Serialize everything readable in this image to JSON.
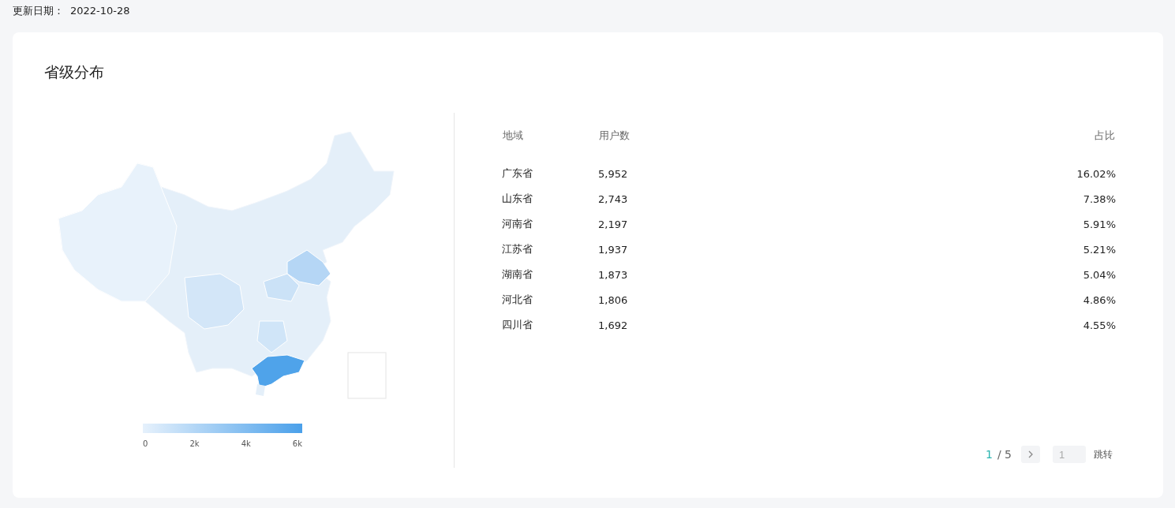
{
  "update": {
    "label": "更新日期：",
    "date": "2022-10-28"
  },
  "card": {
    "title": "省级分布"
  },
  "legend": {
    "ticks": [
      "0",
      "2k",
      "4k",
      "6k"
    ]
  },
  "table": {
    "columns": [
      "地域",
      "用户数",
      "占比"
    ],
    "rows": [
      {
        "region": "广东省",
        "users": "5,952",
        "share": "16.02%"
      },
      {
        "region": "山东省",
        "users": "2,743",
        "share": "7.38%"
      },
      {
        "region": "河南省",
        "users": "2,197",
        "share": "5.91%"
      },
      {
        "region": "江苏省",
        "users": "1,937",
        "share": "5.21%"
      },
      {
        "region": "湖南省",
        "users": "1,873",
        "share": "5.04%"
      },
      {
        "region": "河北省",
        "users": "1,806",
        "share": "4.86%"
      },
      {
        "region": "四川省",
        "users": "1,692",
        "share": "4.55%"
      }
    ]
  },
  "pagination": {
    "current": "1",
    "total": "/ 5",
    "jump_placeholder": "1",
    "jump_button": "跳转"
  }
}
